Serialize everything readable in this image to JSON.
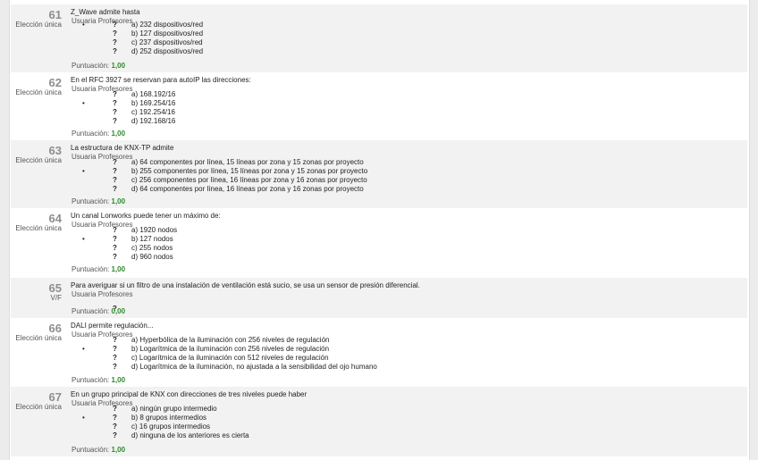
{
  "questions": [
    {
      "number": "61",
      "type": "Elección única",
      "text": "Z_Wave admite hasta",
      "author": "Usuaria Profesores",
      "options": [
        {
          "label": "a)  232 dispositivos/red",
          "marked": true
        },
        {
          "label": "b)  127 dispositivos/red",
          "marked": false
        },
        {
          "label": "c)  237 dispositivos/red",
          "marked": false
        },
        {
          "label": "d)  252 dispositivos/red",
          "marked": false
        }
      ],
      "score_label": "Puntuación:",
      "score_value": "1,00"
    },
    {
      "number": "62",
      "type": "Elección única",
      "text": "En el RFC 3927 se reservan para autoIP las direcciones:",
      "author": "Usuaria Profesores",
      "options": [
        {
          "label": "a)  168.192/16",
          "marked": false
        },
        {
          "label": "b)  169.254/16",
          "marked": true
        },
        {
          "label": "c)  192.254/16",
          "marked": false
        },
        {
          "label": "d)  192.168/16",
          "marked": false
        }
      ],
      "score_label": "Puntuación:",
      "score_value": "1,00"
    },
    {
      "number": "63",
      "type": "Elección única",
      "text": "La estructura de KNX-TP admite",
      "author": "Usuaria Profesores",
      "options": [
        {
          "label": "a)  64 componentes por línea, 15 líneas por zona y 15 zonas por proyecto",
          "marked": false
        },
        {
          "label": "b)  255 componentes por línea, 15 líneas por zona y 15 zonas por proyecto",
          "marked": true
        },
        {
          "label": "c)  256 componentes por línea, 16 líneas por zona y 16 zonas por proyecto",
          "marked": false
        },
        {
          "label": "d)  64 componentes por línea, 16 líneas por zona y 16 zonas por proyecto",
          "marked": false
        }
      ],
      "score_label": "Puntuación:",
      "score_value": "1,00"
    },
    {
      "number": "64",
      "type": "Elección única",
      "text": "Un canal  Lonworks puede tener un máximo de:",
      "author": "Usuaria Profesores",
      "options": [
        {
          "label": "a)  1920 nodos",
          "marked": false
        },
        {
          "label": "b)  127 nodos",
          "marked": true
        },
        {
          "label": "c)  255 nodos",
          "marked": false
        },
        {
          "label": "d)  960 nodos",
          "marked": false
        }
      ],
      "score_label": "Puntuación:",
      "score_value": "1,00"
    },
    {
      "number": "65",
      "type": "V/F",
      "text": "Para averiguar si un filtro de una instalación de ventilación está sucio, se usa un sensor de presión diferencial.",
      "author": "Usuaria Profesores",
      "options": [
        {
          "label": "",
          "marked": false
        }
      ],
      "score_label": "Puntuación:",
      "score_value": "0,00"
    },
    {
      "number": "66",
      "type": "Elección única",
      "text": "DALI permite regulación...",
      "author": "Usuaria Profesores",
      "options": [
        {
          "label": "a)  Hyperbólica de la iluminación con 256 niveles de regulación",
          "marked": false
        },
        {
          "label": "b)  Logarítmica de la iluminación con 256 niveles de regulación",
          "marked": true
        },
        {
          "label": "c)  Logarítmica de la iluminación con 512 niveles de regulación",
          "marked": false
        },
        {
          "label": "d)  Logarítmica de la iluminación, no ajustada a la sensibilidad del ojo humano",
          "marked": false
        }
      ],
      "score_label": "Puntuación:",
      "score_value": "1,00"
    },
    {
      "number": "67",
      "type": "Elección única",
      "text": "En un grupo principal de KNX con direcciones de tres niveles puede haber",
      "author": "Usuaria Profesores",
      "options": [
        {
          "label": "a)  ningún grupo intermedio",
          "marked": false
        },
        {
          "label": "b)  8 grupos intermedios",
          "marked": true
        },
        {
          "label": "c)  16 grupos intermedios",
          "marked": false
        },
        {
          "label": "d)  ninguna de los anteriores es cierta",
          "marked": false
        }
      ],
      "score_label": "Puntuación:",
      "score_value": "1,00"
    }
  ],
  "glyphs": {
    "bullet": "•",
    "question_mark": "?"
  }
}
